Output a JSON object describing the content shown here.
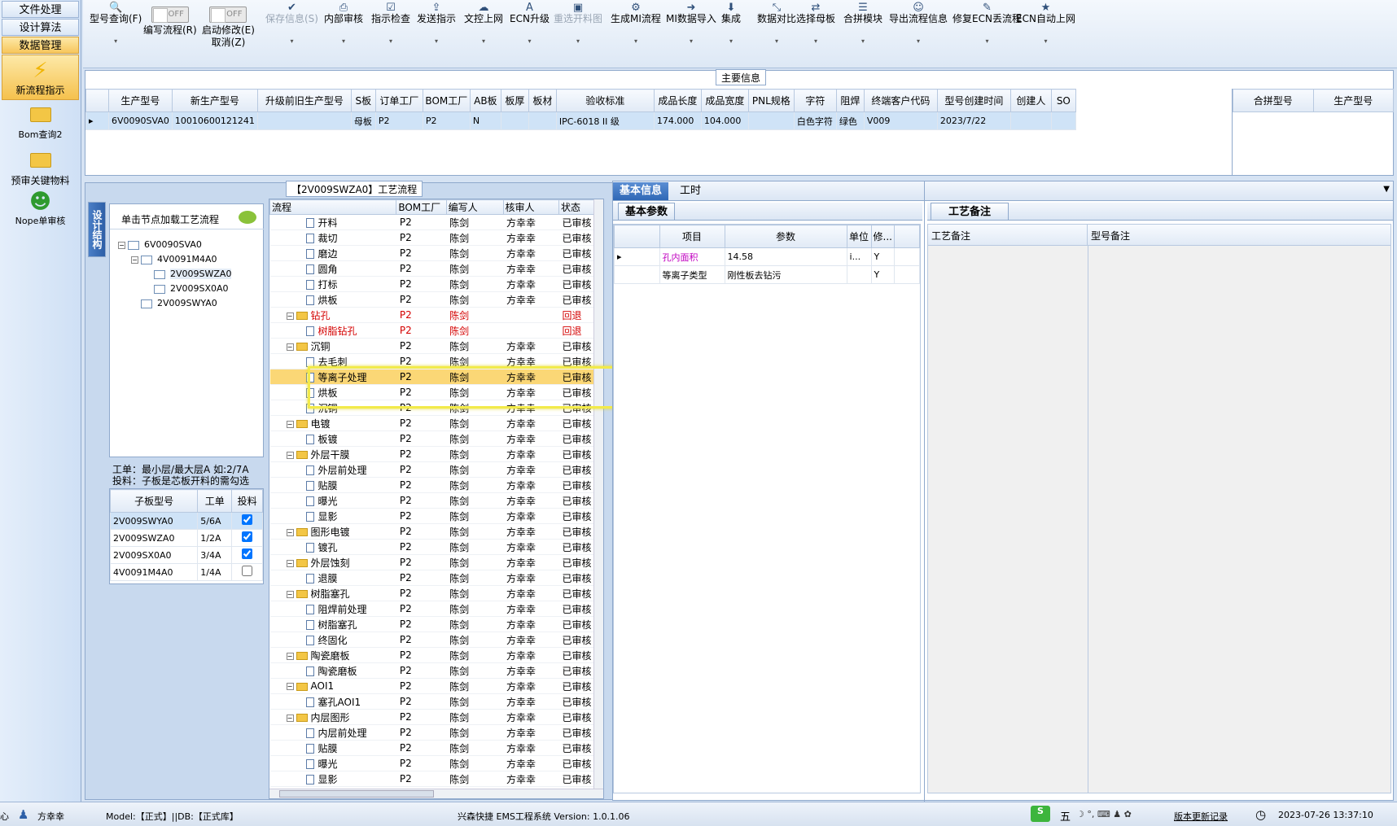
{
  "leftnav": {
    "tabs": [
      "文件处理",
      "设计算法",
      "数据管理"
    ],
    "items": [
      {
        "label": "新流程指示",
        "icon": "lightning-icon"
      },
      {
        "label": "Bom查询2",
        "icon": "folder-icon"
      },
      {
        "label": "预审关键物料",
        "icon": "folder-icon"
      },
      {
        "label": "Nope单审核",
        "icon": "user-icon"
      }
    ]
  },
  "toolbar": {
    "buttons": [
      {
        "label": "型号查询(F)",
        "icon": "search-icon"
      },
      {
        "label": "编写流程(R)",
        "toggle": "OFF"
      },
      {
        "label": "启动修改(E)\n取消(Z)",
        "toggle": "OFF"
      },
      {
        "label": "保存信息(S)",
        "icon": "check-icon",
        "disabled": true
      },
      {
        "label": "内部审核",
        "icon": "print-icon"
      },
      {
        "label": "指示检查",
        "icon": "checkbox-icon"
      },
      {
        "label": "发送指示",
        "icon": "upload-icon"
      },
      {
        "label": "文控上网",
        "icon": "cloud-upload-icon"
      },
      {
        "label": "ECN升级",
        "icon": "font-icon"
      },
      {
        "label": "重选开料图",
        "icon": "image-icon",
        "disabled": true
      },
      {
        "label": "生成MI流程",
        "icon": "gears-icon"
      },
      {
        "label": "MI数据导入",
        "icon": "sign-in-icon"
      },
      {
        "label": "集成",
        "icon": "download-icon"
      },
      {
        "label": "数据对比",
        "icon": "compress-icon"
      },
      {
        "label": "选择母板",
        "icon": "shuffle-icon"
      },
      {
        "label": "合拼模块",
        "icon": "list-icon"
      },
      {
        "label": "导出流程信息",
        "icon": "smile-icon"
      },
      {
        "label": "修复ECN丢流程",
        "icon": "wrench-icon"
      },
      {
        "label": "ECN自动上网",
        "icon": "star-icon"
      }
    ]
  },
  "main": {
    "title": "主要信息",
    "columns": [
      "生产型号",
      "新生产型号",
      "升级前旧生产型号",
      "S板",
      "订单工厂",
      "BOM工厂",
      "AB板",
      "板厚",
      "板材",
      "验收标准",
      "成品长度",
      "成品宽度",
      "PNL规格",
      "字符",
      "阻焊",
      "终端客户代码",
      "型号创建时间",
      "创建人",
      "SO"
    ],
    "rows": [
      [
        "6V0090SVA0",
        "10010600121241",
        "",
        "母板",
        "P2",
        "P2",
        "N",
        "",
        "",
        "IPC-6018 II 级",
        "174.000",
        "104.000",
        "",
        "白色字符",
        "绿色",
        "V009",
        "2023/7/22",
        "",
        ""
      ]
    ],
    "side_columns": [
      "合拼型号",
      "生产型号"
    ]
  },
  "structure": {
    "side_tab": "设计结构",
    "hint": "单击节点加载工艺流程",
    "nodes": [
      "6V0090SVA0",
      "4V0091M4A0",
      "2V009SWZA0",
      "2V009SX0A0",
      "2V009SWYA0"
    ],
    "note1": "工单：最小层/最大层A 如:2/7A",
    "note2": "投料：子板是芯板开料的需勾选",
    "sub_columns": [
      "子板型号",
      "工单",
      "投料"
    ],
    "sub_rows": [
      [
        "2V009SWYA0",
        "5/6A",
        true
      ],
      [
        "2V009SWZA0",
        "1/2A",
        true
      ],
      [
        "2V009SX0A0",
        "3/4A",
        true
      ],
      [
        "4V0091M4A0",
        "1/4A",
        false
      ]
    ]
  },
  "flow": {
    "title": "【2V009SWZA0】工艺流程",
    "columns": [
      "流程",
      "BOM工厂",
      "编写人",
      "核审人",
      "状态"
    ],
    "rows": [
      {
        "name": "开料",
        "lvl": 1,
        "f": "P2",
        "w": "陈剑",
        "r": "方幸幸",
        "s": "已审核"
      },
      {
        "name": "裁切",
        "lvl": 1,
        "f": "P2",
        "w": "陈剑",
        "r": "方幸幸",
        "s": "已审核"
      },
      {
        "name": "磨边",
        "lvl": 1,
        "f": "P2",
        "w": "陈剑",
        "r": "方幸幸",
        "s": "已审核"
      },
      {
        "name": "圆角",
        "lvl": 1,
        "f": "P2",
        "w": "陈剑",
        "r": "方幸幸",
        "s": "已审核"
      },
      {
        "name": "打标",
        "lvl": 1,
        "f": "P2",
        "w": "陈剑",
        "r": "方幸幸",
        "s": "已审核"
      },
      {
        "name": "烘板",
        "lvl": 1,
        "f": "P2",
        "w": "陈剑",
        "r": "方幸幸",
        "s": "已审核"
      },
      {
        "name": "钻孔",
        "lvl": 0,
        "f": "P2",
        "w": "陈剑",
        "r": "",
        "s": "回退",
        "red": true
      },
      {
        "name": "树脂钻孔",
        "lvl": 1,
        "f": "P2",
        "w": "陈剑",
        "r": "",
        "s": "回退",
        "red": true
      },
      {
        "name": "沉铜",
        "lvl": 0,
        "f": "P2",
        "w": "陈剑",
        "r": "方幸幸",
        "s": "已审核"
      },
      {
        "name": "去毛刺",
        "lvl": 1,
        "f": "P2",
        "w": "陈剑",
        "r": "方幸幸",
        "s": "已审核"
      },
      {
        "name": "等离子处理",
        "lvl": 1,
        "f": "P2",
        "w": "陈剑",
        "r": "方幸幸",
        "s": "已审核",
        "hl": true
      },
      {
        "name": "烘板",
        "lvl": 1,
        "f": "P2",
        "w": "陈剑",
        "r": "方幸幸",
        "s": "已审核"
      },
      {
        "name": "沉铜",
        "lvl": 1,
        "f": "P2",
        "w": "陈剑",
        "r": "方幸幸",
        "s": "已审核"
      },
      {
        "name": "电镀",
        "lvl": 0,
        "f": "P2",
        "w": "陈剑",
        "r": "方幸幸",
        "s": "已审核"
      },
      {
        "name": "板镀",
        "lvl": 1,
        "f": "P2",
        "w": "陈剑",
        "r": "方幸幸",
        "s": "已审核"
      },
      {
        "name": "外层干膜",
        "lvl": 0,
        "f": "P2",
        "w": "陈剑",
        "r": "方幸幸",
        "s": "已审核"
      },
      {
        "name": "外层前处理",
        "lvl": 1,
        "f": "P2",
        "w": "陈剑",
        "r": "方幸幸",
        "s": "已审核"
      },
      {
        "name": "贴膜",
        "lvl": 1,
        "f": "P2",
        "w": "陈剑",
        "r": "方幸幸",
        "s": "已审核"
      },
      {
        "name": "曝光",
        "lvl": 1,
        "f": "P2",
        "w": "陈剑",
        "r": "方幸幸",
        "s": "已审核"
      },
      {
        "name": "显影",
        "lvl": 1,
        "f": "P2",
        "w": "陈剑",
        "r": "方幸幸",
        "s": "已审核"
      },
      {
        "name": "图形电镀",
        "lvl": 0,
        "f": "P2",
        "w": "陈剑",
        "r": "方幸幸",
        "s": "已审核"
      },
      {
        "name": "镀孔",
        "lvl": 1,
        "f": "P2",
        "w": "陈剑",
        "r": "方幸幸",
        "s": "已审核"
      },
      {
        "name": "外层蚀刻",
        "lvl": 0,
        "f": "P2",
        "w": "陈剑",
        "r": "方幸幸",
        "s": "已审核"
      },
      {
        "name": "退膜",
        "lvl": 1,
        "f": "P2",
        "w": "陈剑",
        "r": "方幸幸",
        "s": "已审核"
      },
      {
        "name": "树脂塞孔",
        "lvl": 0,
        "f": "P2",
        "w": "陈剑",
        "r": "方幸幸",
        "s": "已审核"
      },
      {
        "name": "阻焊前处理",
        "lvl": 1,
        "f": "P2",
        "w": "陈剑",
        "r": "方幸幸",
        "s": "已审核"
      },
      {
        "name": "树脂塞孔",
        "lvl": 1,
        "f": "P2",
        "w": "陈剑",
        "r": "方幸幸",
        "s": "已审核"
      },
      {
        "name": "终固化",
        "lvl": 1,
        "f": "P2",
        "w": "陈剑",
        "r": "方幸幸",
        "s": "已审核"
      },
      {
        "name": "陶瓷磨板",
        "lvl": 0,
        "f": "P2",
        "w": "陈剑",
        "r": "方幸幸",
        "s": "已审核"
      },
      {
        "name": "陶瓷磨板",
        "lvl": 1,
        "f": "P2",
        "w": "陈剑",
        "r": "方幸幸",
        "s": "已审核"
      },
      {
        "name": "AOI1",
        "lvl": 0,
        "f": "P2",
        "w": "陈剑",
        "r": "方幸幸",
        "s": "已审核"
      },
      {
        "name": "塞孔AOI1",
        "lvl": 1,
        "f": "P2",
        "w": "陈剑",
        "r": "方幸幸",
        "s": "已审核"
      },
      {
        "name": "内层图形",
        "lvl": 0,
        "f": "P2",
        "w": "陈剑",
        "r": "方幸幸",
        "s": "已审核"
      },
      {
        "name": "内层前处理",
        "lvl": 1,
        "f": "P2",
        "w": "陈剑",
        "r": "方幸幸",
        "s": "已审核"
      },
      {
        "name": "贴膜",
        "lvl": 1,
        "f": "P2",
        "w": "陈剑",
        "r": "方幸幸",
        "s": "已审核"
      },
      {
        "name": "曝光",
        "lvl": 1,
        "f": "P2",
        "w": "陈剑",
        "r": "方幸幸",
        "s": "已审核"
      },
      {
        "name": "显影",
        "lvl": 1,
        "f": "P2",
        "w": "陈剑",
        "r": "方幸幸",
        "s": "已审核"
      }
    ]
  },
  "detail": {
    "tabs": [
      "基本信息",
      "工时"
    ],
    "sub_tab": "基本参数",
    "columns": [
      "项目",
      "参数",
      "单位",
      "修..."
    ],
    "rows": [
      [
        "孔内面积",
        "14.58",
        "i...",
        "Y"
      ],
      [
        "等离子类型",
        "刚性板去钻污",
        "",
        "Y"
      ]
    ],
    "remark_tab": "工艺备注",
    "remark_columns": [
      "工艺备注",
      "型号备注"
    ]
  },
  "status": {
    "user": "方幸幸",
    "left": "心",
    "model": "Model:【正式】||DB:【正式库】",
    "app": "兴森快捷 EMS工程系统 Version: 1.0.1.06",
    "link": "版本更新记录",
    "datetime": "2023-07-26 13:37:10",
    "ime": "五"
  }
}
